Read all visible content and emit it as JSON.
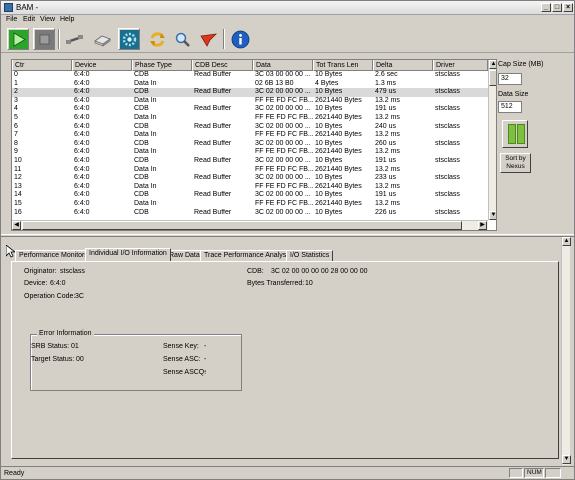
{
  "app": {
    "title": "BAM -"
  },
  "menu": [
    "File",
    "Edit",
    "View",
    "Help"
  ],
  "toolbar": {
    "buttons": [
      "start-icon",
      "stop-icon",
      "cable-icon",
      "disk-icon",
      "settings-icon",
      "refresh-icon",
      "search-icon",
      "flag-icon",
      "info-icon"
    ],
    "colors": {
      "green": "#2aa52a",
      "blue": "#1f5fbf",
      "red": "#d9381e",
      "gold": "#e8b020"
    }
  },
  "grid": {
    "columns": [
      "Ctr",
      "Device",
      "Phase Type",
      "CDB Desc",
      "Data",
      "Tot Trans Len",
      "Delta",
      "Driver"
    ],
    "rows": [
      [
        "0",
        "6:4:0",
        "CDB",
        "Read Buffer",
        "3C 03 00 00 00 ...",
        "10 Bytes",
        "2.6 sec",
        "stsclass"
      ],
      [
        "1",
        "6:4:0",
        "Data In",
        "",
        "02 6B 13 B0",
        "4 Bytes",
        "1.3 ms",
        ""
      ],
      [
        "2",
        "6:4:0",
        "CDB",
        "Read Buffer",
        "3C 02 00 00 00 ...",
        "10 Bytes",
        "479 us",
        "stsclass"
      ],
      [
        "3",
        "6:4:0",
        "Data In",
        "",
        "FF FE FD FC FB...",
        "2621440 Bytes",
        "13.2 ms",
        ""
      ],
      [
        "4",
        "6:4:0",
        "CDB",
        "Read Buffer",
        "3C 02 00 00 00 ...",
        "10 Bytes",
        "191 us",
        "stsclass"
      ],
      [
        "5",
        "6:4:0",
        "Data In",
        "",
        "FF FE FD FC FB...",
        "2621440 Bytes",
        "13.2 ms",
        ""
      ],
      [
        "6",
        "6:4:0",
        "CDB",
        "Read Buffer",
        "3C 02 00 00 00 ...",
        "10 Bytes",
        "240 us",
        "stsclass"
      ],
      [
        "7",
        "6:4:0",
        "Data In",
        "",
        "FF FE FD FC FB...",
        "2621440 Bytes",
        "13.2 ms",
        ""
      ],
      [
        "8",
        "6:4:0",
        "CDB",
        "Read Buffer",
        "3C 02 00 00 00 ...",
        "10 Bytes",
        "260 us",
        "stsclass"
      ],
      [
        "9",
        "6:4:0",
        "Data In",
        "",
        "FF FE FD FC FB...",
        "2621440 Bytes",
        "13.2 ms",
        ""
      ],
      [
        "10",
        "6:4:0",
        "CDB",
        "Read Buffer",
        "3C 02 00 00 00 ...",
        "10 Bytes",
        "191 us",
        "stsclass"
      ],
      [
        "11",
        "6:4:0",
        "Data In",
        "",
        "FF FE FD FC FB...",
        "2621440 Bytes",
        "13.2 ms",
        ""
      ],
      [
        "12",
        "6:4:0",
        "CDB",
        "Read Buffer",
        "3C 02 00 00 00 ...",
        "10 Bytes",
        "233 us",
        "stsclass"
      ],
      [
        "13",
        "6:4:0",
        "Data In",
        "",
        "FF FE FD FC FB...",
        "2621440 Bytes",
        "13.2 ms",
        ""
      ],
      [
        "14",
        "6:4:0",
        "CDB",
        "Read Buffer",
        "3C 02 00 00 00 ...",
        "10 Bytes",
        "191 us",
        "stsclass"
      ],
      [
        "15",
        "6:4:0",
        "Data In",
        "",
        "FF FE FD FC FB...",
        "2621440 Bytes",
        "13.2 ms",
        ""
      ],
      [
        "16",
        "6:4:0",
        "CDB",
        "Read Buffer",
        "3C 02 00 00 00 ...",
        "10 Bytes",
        "226 us",
        "stsclass"
      ]
    ],
    "selected_row": 2
  },
  "side": {
    "cap_size_label": "Cap Size (MB)",
    "cap_size_value": "32",
    "data_size_label": "Data Size",
    "data_size_value": "512",
    "sort_label_1": "Sort by",
    "sort_label_2": "Nexus"
  },
  "tabs": [
    "Performance Monitors",
    "Individual I/O Information",
    "Raw Data",
    "Trace Performance Analysis",
    "I/O Statistics"
  ],
  "active_tab": 1,
  "details": {
    "originator_label": "Originator:",
    "originator_value": "stsclass",
    "device_label": "Device:",
    "device_value": "6:4:0",
    "opcode_label": "Operation Code:",
    "opcode_value": "3C",
    "cdb_label": "CDB:",
    "cdb_value": "3C 02 00 00 00 00 28 00 00 00",
    "bytes_label": "Bytes Transferred:",
    "bytes_value": "10",
    "error_legend": "Error Information",
    "srb_label": "SRB Status:",
    "srb_value": "01",
    "target_label": "Target Status:",
    "target_value": "00",
    "sense_key_label": "Sense Key:",
    "sense_key_value": "-",
    "sense_asc_label": "Sense ASC:",
    "sense_asc_value": "-",
    "sense_ascq_label": "Sense ASCQ:",
    "sense_ascq_value": "-"
  },
  "status": {
    "text": "Ready",
    "num": "NUM"
  }
}
